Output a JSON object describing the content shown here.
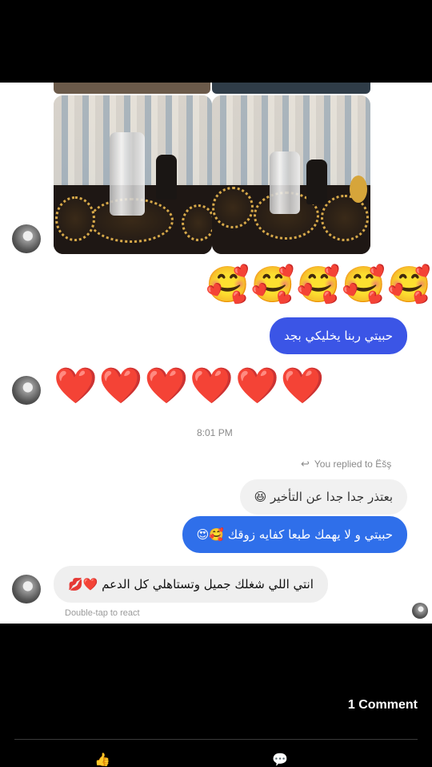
{
  "thread": {
    "photos": [
      {
        "name": "photo-vase-1"
      },
      {
        "name": "photo-vase-2"
      }
    ],
    "messages": {
      "emoji_hearts_face": "🥰🥰🥰🥰🥰",
      "sent_1": "حبيتي ربنا يخليكي بجد",
      "emoji_hearts": "❤️❤️❤️❤️❤️❤️",
      "timestamp": "8:01 PM",
      "reply_label": "You replied to Ëšş",
      "quoted": "بعتذر جدا جدا عن التأخير 😆",
      "sent_2": "حبيتي و لا يهمك طبعا كفايه زوقك 🥰😍",
      "received_last": "انتي اللي شغلك جميل وتستاهلي كل الدعم ❤️💋",
      "double_tap_hint": "Double-tap to react"
    }
  },
  "footer": {
    "comment_count": "1 Comment"
  }
}
